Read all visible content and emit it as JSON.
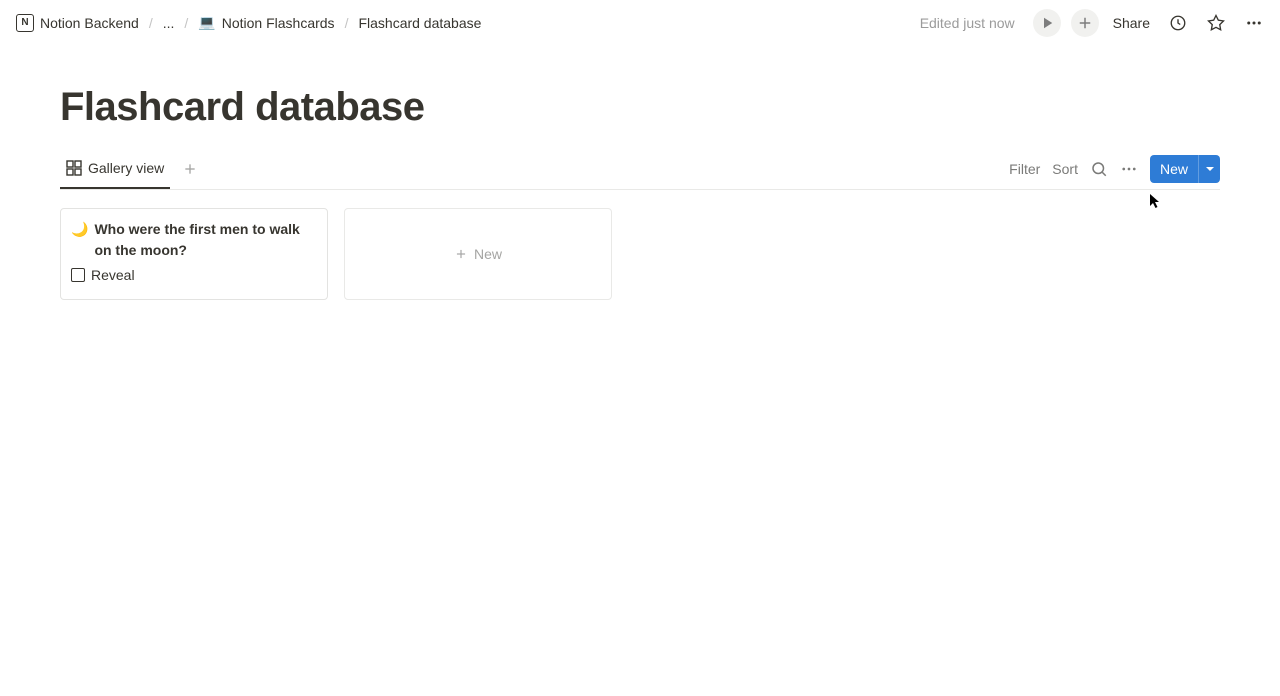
{
  "breadcrumb": {
    "root": "Notion Backend",
    "ellipsis": "...",
    "parent": "Notion Flashcards",
    "current": "Flashcard database",
    "parent_emoji": "💻"
  },
  "topbar": {
    "edited": "Edited just now",
    "share": "Share"
  },
  "page": {
    "title": "Flashcard database"
  },
  "views": {
    "active": "Gallery view"
  },
  "controls": {
    "filter": "Filter",
    "sort": "Sort",
    "new": "New"
  },
  "cards": [
    {
      "emoji": "🌙",
      "title": "Who were the first men to walk on the moon?",
      "reveal_label": "Reveal",
      "reveal_checked": false
    }
  ],
  "gallery": {
    "new_card": "New"
  }
}
